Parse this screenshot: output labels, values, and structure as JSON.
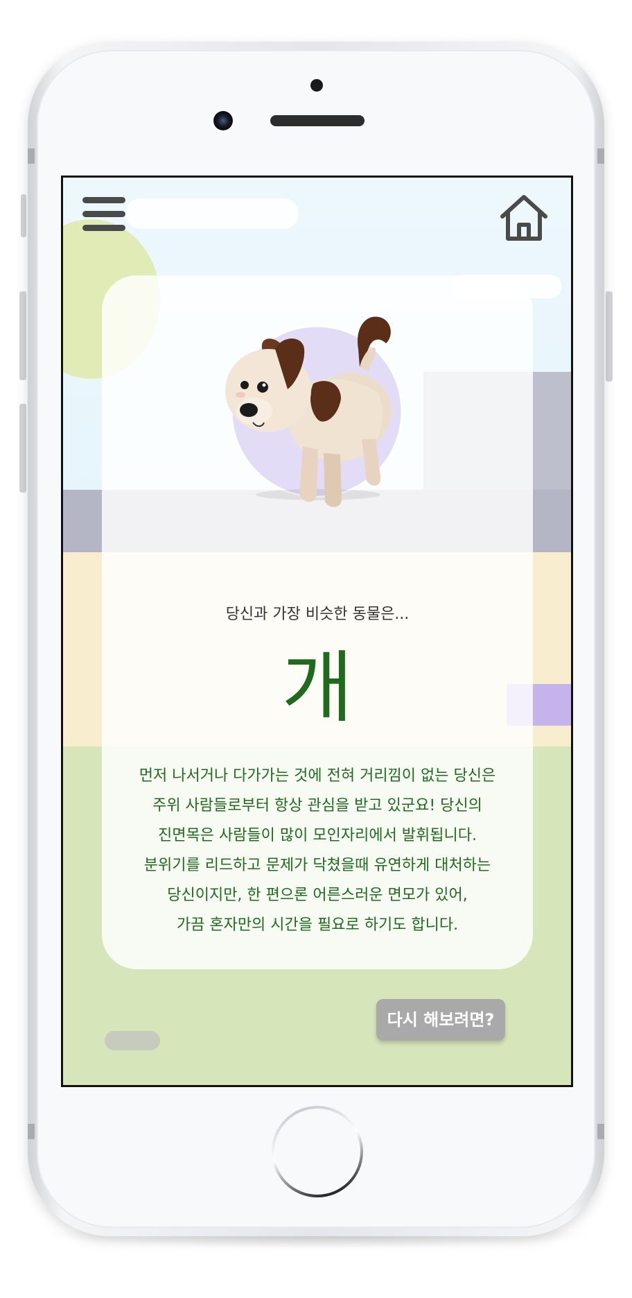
{
  "result": {
    "subtitle": "당신과 가장 비슷한 동물은...",
    "animal": "개",
    "description_lines": [
      "먼저 나서거나 다가가는 것에 전혀 거리낌이 없는 당신은",
      "주위 사람들로부터 항상 관심을 받고 있군요! 당신의",
      "진면목은 사람들이 많이 모인자리에서 발휘됩니다.",
      "분위기를 리드하고 문제가 닥쳤을때 유연하게 대처하는",
      "당신이지만, 한 편으론 어른스러운 면모가 있어,",
      "가끔 혼자만의 시간을 필요로 하기도 합니다."
    ]
  },
  "buttons": {
    "retry_label": "다시 해보려면?"
  },
  "icons": {
    "menu": "hamburger-menu-icon",
    "home": "house-icon",
    "animal": "dog-illustration"
  },
  "colors": {
    "result_text": "#1e6b1e",
    "retry_button": "#a9a9a9",
    "dog_circle": "#e3dcf7"
  }
}
